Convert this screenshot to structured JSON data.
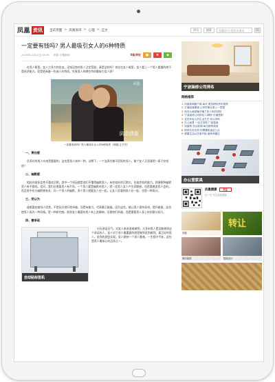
{
  "header": {
    "logo": "凤凰",
    "logo_tag": "资讯",
    "breadcrumb": [
      "当前页面",
      ">",
      "凤凰资讯",
      ">",
      "心理",
      ">",
      "正文"
    ],
    "btn_one": "资讯",
    "btn_two": "搜索",
    "search_placeholder": "凤凰资讯 搜索关键词"
  },
  "article": {
    "title": "一定要有钱吗? 男人最吸引女人的6种特质",
    "date": "2016年12月02日 08:46",
    "source": "来源: 中国新网",
    "comment_count": "0条评论",
    "share_colors": [
      "#e8a33b",
      "#d9483b",
      "#6db33f"
    ],
    "intro": "在男人眼里，女人大多为何金女。没钱没势的男人注定悲剧，真是这样吗？其实在女人眼里，女人看上一个男人看重的绝不是经济能力。而是更具备一些迷人的特质。究竟男人的哪些特质最吸引女人呢？",
    "photo_watermark": "凤凰健康",
    "photo_watermark_top": "凤凰",
    "caption": "一定要有钱吗? 男人最吸引女人的6种特质（网图/主子们）",
    "section1_title": "一、责任感",
    "section1_text": "负责任的男人向来是重要的，这也是男人体的一种。试想下，一个连责任都不愿担的男人，能个女人又愿意把一辈子交给他？",
    "section2_title": "二、幽默感",
    "section2_text": "相处的很多女性不喜欢沉默，其中一个原因就是他们不懂得幽默男人。有些较好的沉默位，拉维克机的能力，即便那种幽默男人有不错的。话问，我们还需要男人有不同，一个男人要是幽默的男人，就一定男人女人产生家解感，也是要做追男人会的。而且其中也与幽默感有关，问一个男人的幽默，多少男人就要女人在一起，让女人愿意和男人在一起，也是一种高分。",
    "section3_title": "三、受认为",
    "section3_text": "谁都喜欢被别人欣赏，不是因为他行他卓越，而是有能力。代表着正能量。因为这些，能让男人保持身材，提升能量，这也使男人成为一种风格。是一种研究感。很多女人最喜欢男人有上进精神，无需他们卓越，而是需要男人身上的刻意与努力。",
    "section4_title": "四、善承诺",
    "section4_text": "对无承诺无气，对女人来说很难做到，大多的男人是没能做到这个承诺的人。女人对于男人最重要的就是做到说到做到。真正好的男人，说到的就会实现。女人期待一个男人靠谱，一生相守不弃，这也是男人最核心的品质之一。",
    "machine_ad_label": "自动贴标签机"
  },
  "sidebar": {
    "ad1_caption": "宁波装修公司排名",
    "news_head": "网络推荐",
    "news": [
      {
        "num": "1",
        "text": "凤凰新闻客户端 每天 更多精彩资讯推荐"
      },
      {
        "num": "2",
        "text": "打通经营渠道 让你的事业更上一层楼"
      },
      {
        "num": "3",
        "text": "他怎么就被骗子骗了多少年的钱财"
      },
      {
        "num": "4",
        "text": "宁波装修公司排名 口碑好 价格透明"
      },
      {
        "num": "5",
        "text": "这些年轻人的生活方式 你认同吗"
      },
      {
        "num": "6",
        "text": "办公家具 一站式采购 厂家直销"
      },
      {
        "num": "7",
        "text": "凤凰网 热点新闻 每日推荐阅读"
      },
      {
        "num": "8",
        "text": "职场生存法则 你需要知道这几点"
      },
      {
        "num": "9",
        "text": "健康生活从饮食开始 营养师建议"
      }
    ],
    "ad2_caption": "办公室家具",
    "qr_title": "凤凰健康",
    "follow": "关注",
    "qr_sub": "扫一扫 关注凤凰健康",
    "tiles": [
      "天能",
      "转让",
      "简约装修",
      "智能设计"
    ],
    "tile_big": "转让"
  }
}
